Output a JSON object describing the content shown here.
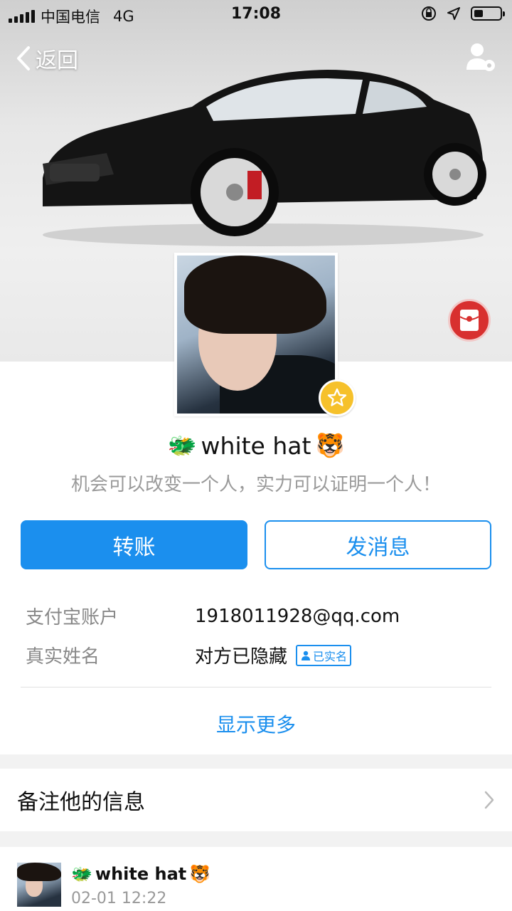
{
  "status_bar": {
    "carrier": "中国电信",
    "network": "4G",
    "time": "17:08"
  },
  "nav": {
    "back_label": "返回"
  },
  "profile": {
    "name": "white hat",
    "name_prefix_emoji": "🐲",
    "name_suffix_emoji": "🐯",
    "signature": "机会可以改变一个人，实力可以证明一个人！"
  },
  "actions": {
    "transfer_label": "转账",
    "message_label": "发消息"
  },
  "info": {
    "account_label": "支付宝账户",
    "account_value": "1918011928@qq.com",
    "realname_label": "真实姓名",
    "realname_value": "对方已隐藏",
    "verified_badge": "已实名"
  },
  "show_more_label": "显示更多",
  "remark": {
    "label": "备注他的信息"
  },
  "feed": {
    "name": "white hat",
    "time": "02-01 12:22"
  },
  "colors": {
    "accent": "#1b8fee",
    "redpacket": "#d8302f",
    "star_badge": "#f6c12b"
  }
}
